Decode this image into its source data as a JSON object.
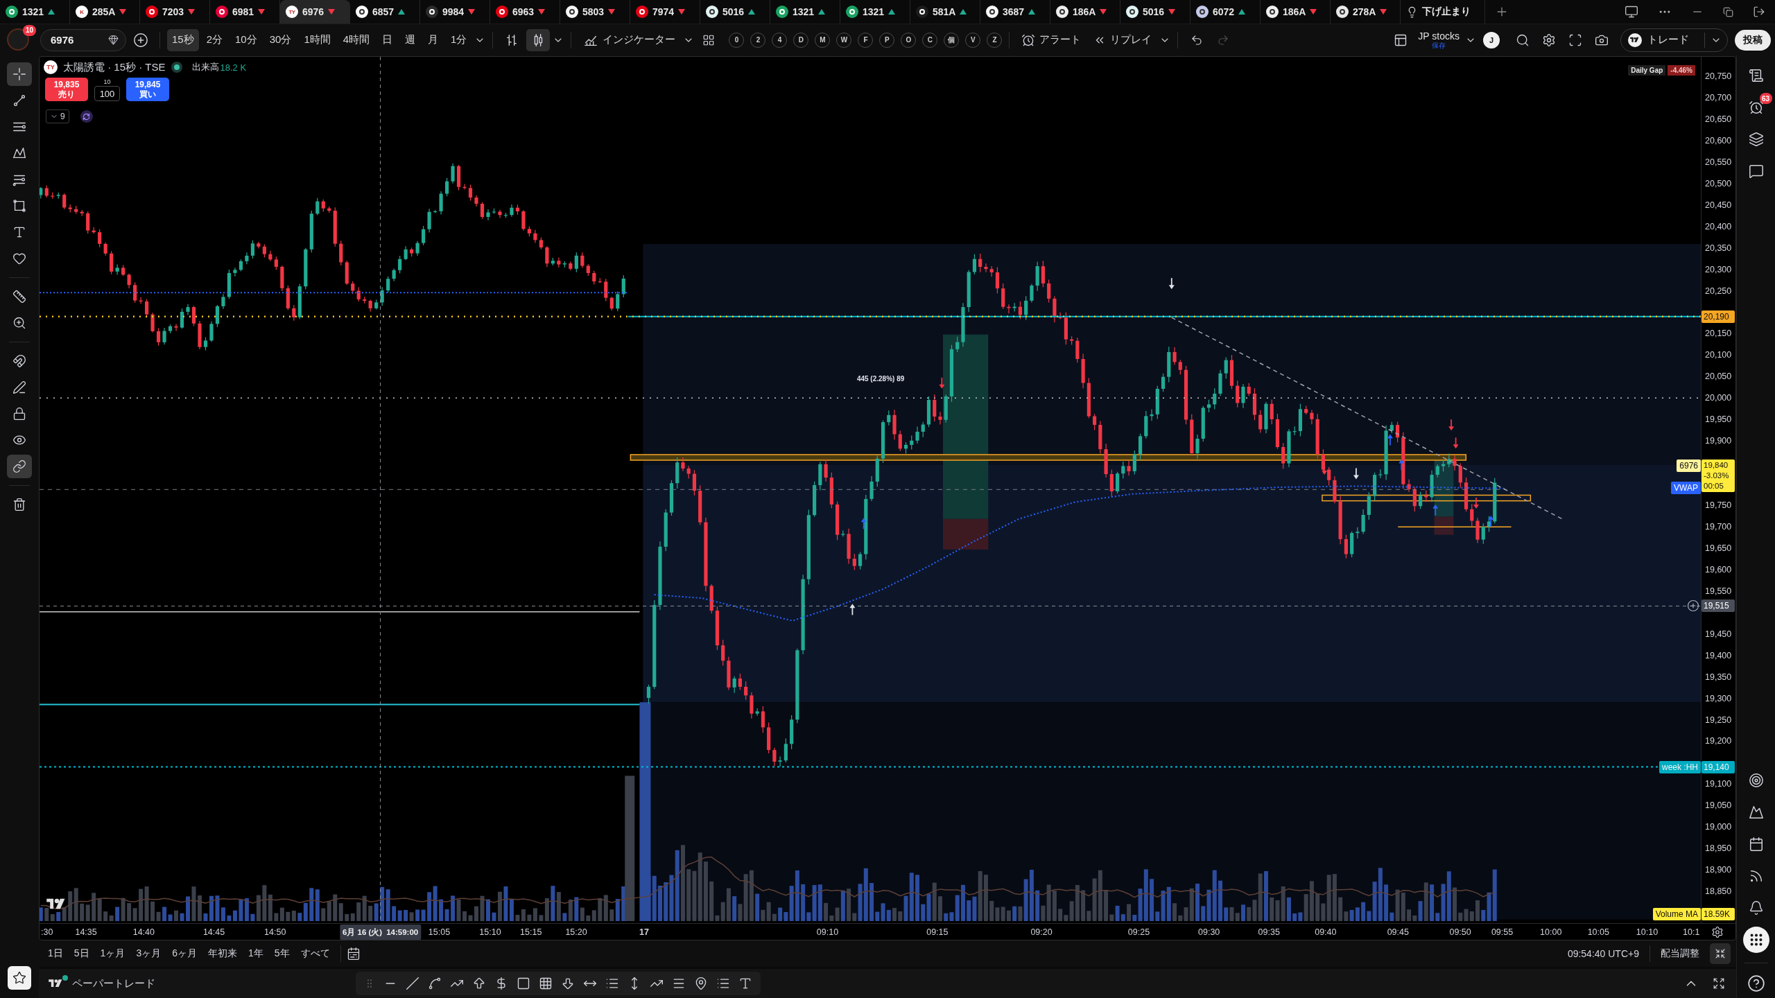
{
  "tabs": [
    {
      "kind": "symbol",
      "symbol": "1321",
      "rising": true,
      "color": "#1aa260",
      "selected": false
    },
    {
      "kind": "symbol",
      "symbol": "285A",
      "rising": false,
      "color": "#ffffff",
      "logo_text": "K",
      "selected": false
    },
    {
      "kind": "symbol",
      "symbol": "7203",
      "rising": false,
      "color": "#e60012",
      "selected": false
    },
    {
      "kind": "symbol",
      "symbol": "6981",
      "rising": false,
      "color": "#e50039",
      "selected": false
    },
    {
      "kind": "symbol",
      "symbol": "6976",
      "rising": false,
      "color": "#ffffff",
      "logo_text": "TY",
      "selected": true
    },
    {
      "kind": "symbol",
      "symbol": "6857",
      "rising": true,
      "color": "#fafafa",
      "selected": false
    },
    {
      "kind": "symbol",
      "symbol": "9984",
      "rising": false,
      "color": "#2b2b2b",
      "selected": false
    },
    {
      "kind": "symbol",
      "symbol": "6963",
      "rising": false,
      "color": "#e50012",
      "selected": false
    },
    {
      "kind": "symbol",
      "symbol": "5803",
      "rising": false,
      "color": "#f5f5f5",
      "selected": false
    },
    {
      "kind": "symbol",
      "symbol": "7974",
      "rising": false,
      "color": "#e60014",
      "selected": false
    },
    {
      "kind": "symbol",
      "symbol": "5016",
      "rising": true,
      "color": "#e0f2f1",
      "selected": false
    },
    {
      "kind": "symbol",
      "symbol": "1321",
      "rising": true,
      "color": "#1aa261",
      "selected": false
    },
    {
      "kind": "symbol",
      "symbol": "1321",
      "rising": true,
      "color": "#1aa262",
      "selected": false
    },
    {
      "kind": "symbol",
      "symbol": "581A",
      "rising": true,
      "color": "#1c1c1c",
      "selected": false
    },
    {
      "kind": "symbol",
      "symbol": "3687",
      "rising": true,
      "color": "#f7f7f7",
      "selected": false
    },
    {
      "kind": "symbol",
      "symbol": "186A",
      "rising": false,
      "color": "#eeeeee",
      "selected": false
    },
    {
      "kind": "symbol",
      "symbol": "5016",
      "rising": false,
      "color": "#e0f2f2",
      "selected": false
    },
    {
      "kind": "symbol",
      "symbol": "6072",
      "rising": true,
      "color": "#c5cae9",
      "selected": false
    },
    {
      "kind": "symbol",
      "symbol": "186A",
      "rising": false,
      "color": "#efefef",
      "selected": false
    },
    {
      "kind": "symbol",
      "symbol": "278A",
      "rising": false,
      "color": "#e8e8e8",
      "selected": false
    },
    {
      "kind": "note",
      "symbol": "下げ止まり",
      "selected": false
    }
  ],
  "toolbar": {
    "notifications": "10",
    "symbol": "6976",
    "intervals": [
      {
        "label": "15秒",
        "selected": true
      },
      {
        "label": "2分",
        "selected": false
      },
      {
        "label": "10分",
        "selected": false
      },
      {
        "label": "30分",
        "selected": false
      },
      {
        "label": "1時間",
        "selected": false
      },
      {
        "label": "4時間",
        "selected": false
      },
      {
        "label": "日",
        "selected": false
      },
      {
        "label": "週",
        "selected": false
      },
      {
        "label": "月",
        "selected": false
      },
      {
        "label": "1分",
        "selected": false
      }
    ],
    "chart_types": [
      {
        "kind": "bars",
        "selected": false
      },
      {
        "kind": "candles",
        "selected": true
      }
    ],
    "indicators": "インジケーター",
    "quick_buttons": [
      "0",
      "2",
      "4",
      "D",
      "M",
      "W",
      "F",
      "P",
      "O",
      "C",
      "個",
      "V",
      "Z"
    ],
    "alert": "アラート",
    "replay": "リプレイ",
    "redo_enabled": false,
    "layout_name": "JP stocks",
    "layout_status": "保存",
    "user_initial": "J",
    "trade": "トレード",
    "publish": "投稿"
  },
  "left_toolbar": [
    {
      "kind": "crosshair",
      "selected": true
    },
    {
      "kind": "trend-line",
      "selected": false
    },
    {
      "kind": "fib",
      "selected": false
    },
    {
      "kind": "pattern",
      "selected": false
    },
    {
      "kind": "forecast",
      "selected": false
    },
    {
      "kind": "shape",
      "selected": false
    },
    {
      "kind": "text",
      "selected": false
    },
    {
      "kind": "heart",
      "selected": false
    },
    {
      "kind": "ruler",
      "selected": false
    },
    {
      "kind": "zoom",
      "selected": false
    },
    {
      "kind": "magnet",
      "selected": false
    },
    {
      "kind": "pencil",
      "selected": false
    },
    {
      "kind": "lock",
      "selected": false
    },
    {
      "kind": "eye",
      "selected": false
    },
    {
      "kind": "link",
      "selected": true
    },
    {
      "kind": "trash",
      "selected": false
    }
  ],
  "legend": {
    "logo_text": "TY",
    "title": "太陽誘電 · 15秒 · TSE",
    "market_open": true,
    "volume_label": "出来高",
    "volume_value": "18.2 K"
  },
  "order": {
    "sell_price": "19,835",
    "sell_label": "売り",
    "step": "10",
    "quantity": "100",
    "buy_price": "19,845",
    "buy_label": "買い"
  },
  "indicator_group": {
    "count": "9"
  },
  "chart": {
    "daily_gap": {
      "label": "Daily Gap",
      "value": "-4.46%"
    },
    "measure": "445 (2.28%) 89",
    "price_labels": [
      "20,750",
      "20,700",
      "20,650",
      "20,600",
      "20,550",
      "20,500",
      "20,450",
      "20,400",
      "20,350",
      "20,300",
      "20,250",
      "20,150",
      "20,100",
      "20,050",
      "20,000",
      "19,950",
      "19,900",
      "19,750",
      "19,700",
      "19,650",
      "19,600",
      "19,550",
      "19,450",
      "19,400",
      "19,350",
      "19,300",
      "19,250",
      "19,200",
      "19,100",
      "19,050",
      "19,000",
      "18,950",
      "18,900",
      "18,850"
    ],
    "badges": [
      {
        "kind": "alert_line",
        "value": "20,190"
      },
      {
        "kind": "last_price",
        "symbol": "6976",
        "value": "19,840",
        "change": "-3.03%",
        "countdown": "00:05"
      },
      {
        "kind": "vwap",
        "label": "VWAP"
      },
      {
        "kind": "crosshair",
        "value": "19,515"
      },
      {
        "kind": "week_high",
        "label": "week :HH",
        "value": "19,140"
      },
      {
        "kind": "volume_ma",
        "label": "Volume MA",
        "value": "18.59K"
      }
    ],
    "time_labels": [
      {
        "label": ":30",
        "kind": "time"
      },
      {
        "label": "14:35",
        "kind": "time"
      },
      {
        "label": "14:40",
        "kind": "time"
      },
      {
        "label": "14:45",
        "kind": "time"
      },
      {
        "label": "14:50",
        "kind": "time"
      },
      {
        "label": "15:05",
        "kind": "time"
      },
      {
        "label": "15:10",
        "kind": "time"
      },
      {
        "label": "15:15",
        "kind": "time"
      },
      {
        "label": "15:20",
        "kind": "time"
      },
      {
        "label": "17",
        "kind": "day"
      },
      {
        "label": "09:10",
        "kind": "time"
      },
      {
        "label": "09:15",
        "kind": "time"
      },
      {
        "label": "09:20",
        "kind": "time"
      },
      {
        "label": "09:25",
        "kind": "time"
      },
      {
        "label": "09:30",
        "kind": "time"
      },
      {
        "label": "09:35",
        "kind": "time"
      },
      {
        "label": "09:40",
        "kind": "time"
      },
      {
        "label": "09:45",
        "kind": "time"
      },
      {
        "label": "09:50",
        "kind": "time"
      },
      {
        "label": "09:55",
        "kind": "time"
      },
      {
        "label": "10:00",
        "kind": "time"
      },
      {
        "label": "10:05",
        "kind": "time"
      },
      {
        "label": "10:10",
        "kind": "time"
      },
      {
        "label": "10:1",
        "kind": "time"
      }
    ],
    "crosshair_time": {
      "date": "6月 16 (火)",
      "time": "14:59:00"
    }
  },
  "right_toolbar": {
    "top": [
      {
        "kind": "watchlist",
        "selected": false
      },
      {
        "kind": "alerts",
        "badge": "63",
        "selected": false
      },
      {
        "kind": "layers",
        "selected": false
      },
      {
        "kind": "chat",
        "selected": false
      }
    ],
    "bottom": [
      {
        "kind": "target",
        "selected": false
      },
      {
        "kind": "ideas",
        "selected": false
      },
      {
        "kind": "calendar",
        "selected": false
      },
      {
        "kind": "news",
        "selected": false
      },
      {
        "kind": "notifications",
        "selected": false
      },
      {
        "kind": "apps",
        "selected": true
      }
    ]
  },
  "range_bar": {
    "ranges": [
      "1日",
      "5日",
      "1ヶ月",
      "3ヶ月",
      "6ヶ月",
      "年初来",
      "1年",
      "5年",
      "すべて"
    ],
    "clock": "09:54:40 UTC+9",
    "adjust": "配当調整"
  },
  "bottom_panel": {
    "title": "ペーパートレード",
    "connected": true
  }
}
